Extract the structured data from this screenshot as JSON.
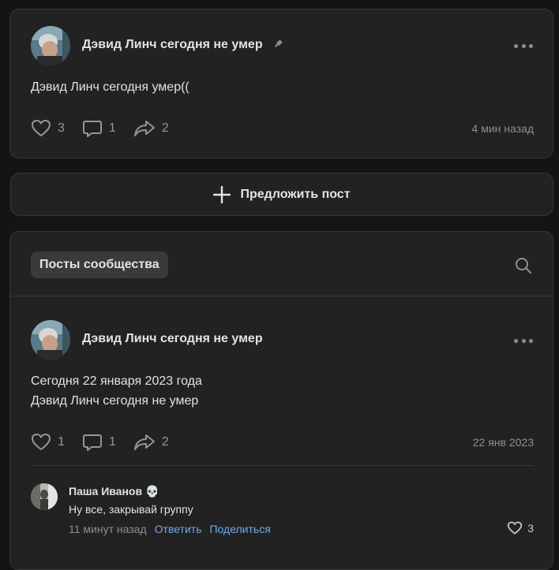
{
  "pinned_post": {
    "author": "Дэвид Линч сегодня не умер",
    "text": "Дэвид Линч сегодня умер((",
    "likes": "3",
    "comments": "1",
    "shares": "2",
    "time": "4 мин назад",
    "pinned": true
  },
  "suggest": {
    "label": "Предложить пост"
  },
  "feed": {
    "tab_label": "Посты сообщества",
    "post": {
      "author": "Дэвид Линч сегодня не умер",
      "text_line1": "Сегодня 22 января 2023 года",
      "text_line2": "Дэвид Линч сегодня не умер",
      "likes": "1",
      "comments": "1",
      "shares": "2",
      "time": "22 янв 2023"
    },
    "comment": {
      "author": "Паша Иванов",
      "emoji": "💀",
      "text": "Ну все, закрывай группу",
      "time": "11 минут назад",
      "reply_label": "Ответить",
      "share_label": "Поделиться",
      "likes": "3"
    }
  },
  "colors": {
    "background": "#141414",
    "card": "#222222",
    "link": "#71aaeb",
    "muted": "#8c8f93"
  }
}
